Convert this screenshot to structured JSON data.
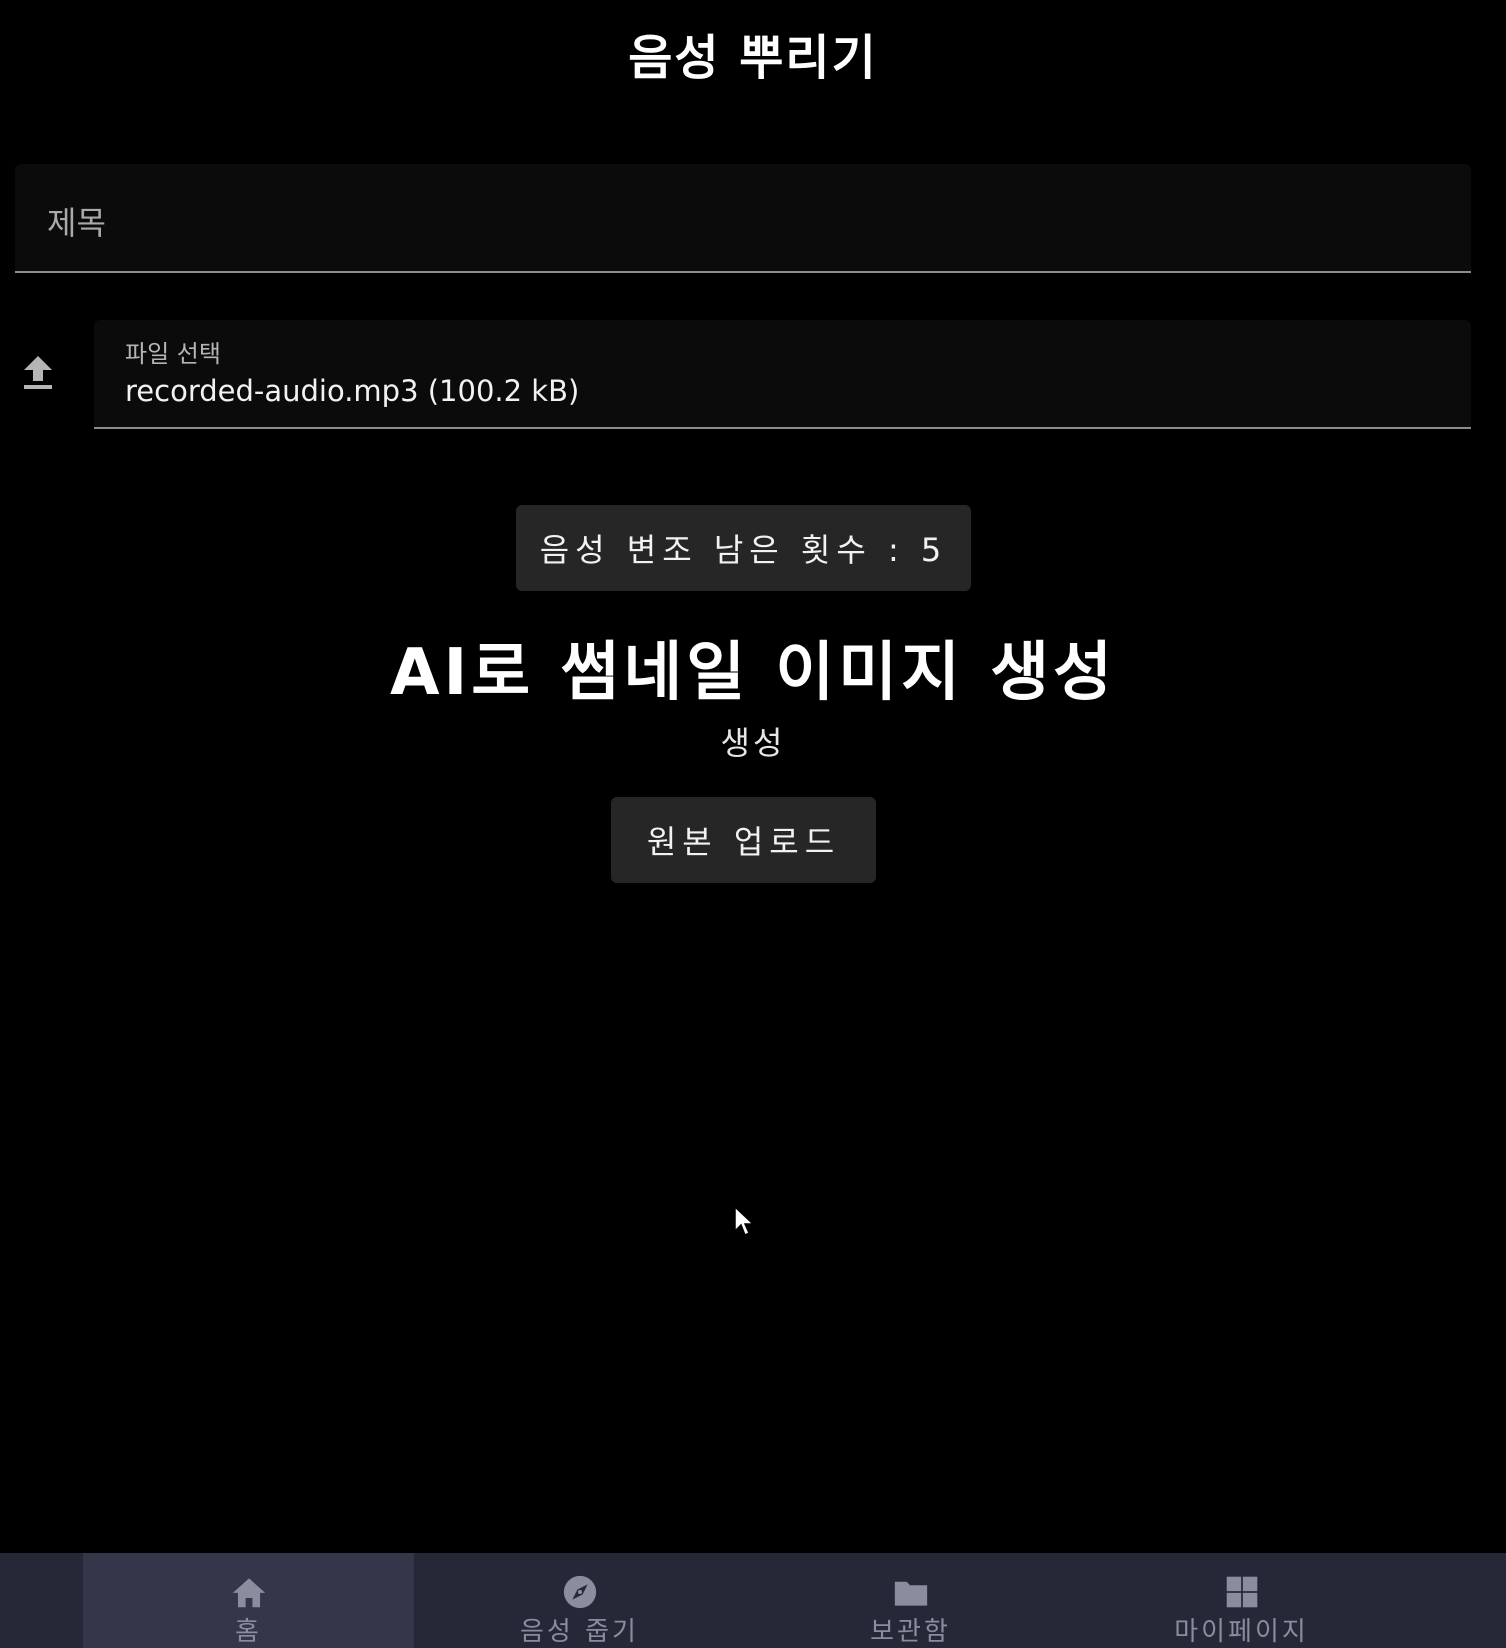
{
  "header": {
    "title": "음성 뿌리기"
  },
  "form": {
    "title_placeholder": "제목",
    "file_label": "파일 선택",
    "file_value": "recorded-audio.mp3 (100.2 kB)",
    "upload_icon": "upload-icon"
  },
  "voice_change": {
    "remaining_text": "음성 변조 남은 횟수 : 5",
    "remaining_count": 5
  },
  "thumbnail": {
    "heading": "AI로 썸네일 이미지 생성",
    "generate_label": "생성"
  },
  "actions": {
    "original_upload_label": "원본 업로드"
  },
  "bottom_nav": {
    "items": [
      {
        "label": "홈",
        "icon": "home-icon",
        "active": true
      },
      {
        "label": "음성 줍기",
        "icon": "compass-icon",
        "active": false
      },
      {
        "label": "보관함",
        "icon": "folder-icon",
        "active": false
      },
      {
        "label": "마이페이지",
        "icon": "grid-icon",
        "active": false
      }
    ]
  },
  "colors": {
    "background": "#000000",
    "field_background": "#0b0b0b",
    "button_background": "#262626",
    "nav_background": "#262837",
    "nav_active": "#34374a",
    "nav_inactive_text": "#8a8d9e"
  }
}
